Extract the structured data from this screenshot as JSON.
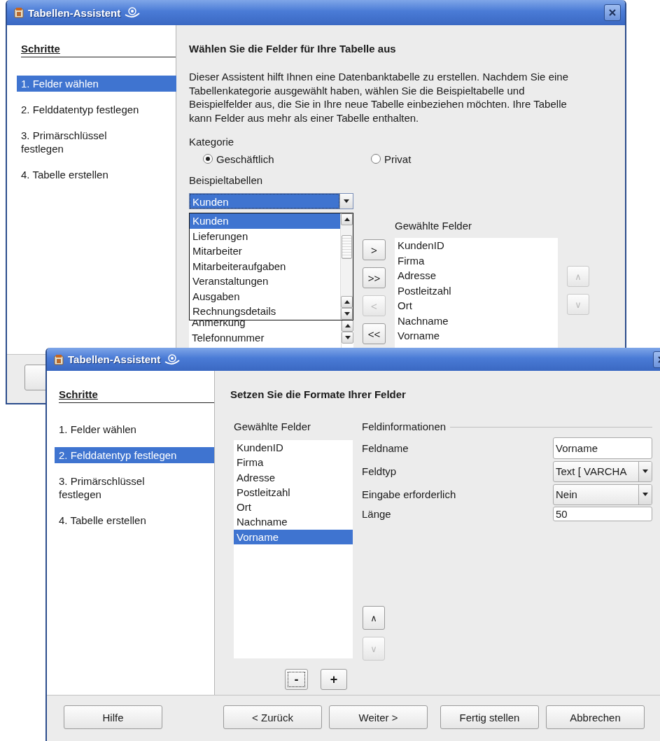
{
  "back_window": {
    "title": "Tabellen-Assistent",
    "steps_heading": "Schritte",
    "steps": [
      {
        "label": "1. Felder wählen",
        "selected": true
      },
      {
        "label": "2. Felddatentyp festlegen",
        "selected": false
      },
      {
        "label": "3. Primärschlüssel festlegen",
        "selected": false
      },
      {
        "label": "4. Tabelle erstellen",
        "selected": false
      }
    ],
    "heading": "Wählen Sie die Felder für Ihre Tabelle aus",
    "description": "Dieser Assistent hilft Ihnen eine Datenbanktabelle zu erstellen. Nachdem Sie eine Tabellenkategorie ausgewählt haben, wählen Sie die Beispieltabelle und Beispielfelder aus, die Sie in Ihre neue Tabelle einbeziehen möchten. Ihre Tabelle kann Felder aus mehr als einer Tabelle enthalten.",
    "category": {
      "label": "Kategorie",
      "options": [
        {
          "label": "Geschäftlich",
          "selected": true
        },
        {
          "label": "Privat",
          "selected": false
        }
      ]
    },
    "sample_tables": {
      "label": "Beispieltabellen",
      "value": "Kunden",
      "dropdown": [
        {
          "label": "Kunden",
          "selected": true
        },
        {
          "label": "Lieferungen",
          "selected": false
        },
        {
          "label": "Mitarbeiter",
          "selected": false
        },
        {
          "label": "Mitarbeiteraufgaben",
          "selected": false
        },
        {
          "label": "Veranstaltungen",
          "selected": false
        },
        {
          "label": "Ausgaben",
          "selected": false
        },
        {
          "label": "Rechnungsdetails",
          "selected": false
        }
      ]
    },
    "available_fields": [
      "Anmerkung",
      "Telefonnummer"
    ],
    "move_buttons": [
      {
        "label": ">",
        "disabled": false
      },
      {
        "label": ">>",
        "disabled": false
      },
      {
        "label": "<",
        "disabled": true
      },
      {
        "label": "<<",
        "disabled": false
      }
    ],
    "selected_fields": {
      "label": "Gewählte Felder",
      "items": [
        "KundenID",
        "Firma",
        "Adresse",
        "Postleitzahl",
        "Ort",
        "Nachname",
        "Vorname"
      ]
    },
    "order_buttons": [
      {
        "label": "∧",
        "disabled": true
      },
      {
        "label": "∨",
        "disabled": true
      }
    ]
  },
  "front_window": {
    "title": "Tabellen-Assistent",
    "steps_heading": "Schritte",
    "steps": [
      {
        "label": "1. Felder wählen",
        "selected": false
      },
      {
        "label": "2. Felddatentyp festlegen",
        "selected": true
      },
      {
        "label": "3. Primärschlüssel festlegen",
        "selected": false
      },
      {
        "label": "4. Tabelle erstellen",
        "selected": false
      }
    ],
    "heading": "Setzen Sie die Formate Ihrer Felder",
    "selected_fields": {
      "label": "Gewählte Felder",
      "items": [
        {
          "label": "KundenID",
          "selected": false
        },
        {
          "label": "Firma",
          "selected": false
        },
        {
          "label": "Adresse",
          "selected": false
        },
        {
          "label": "Postleitzahl",
          "selected": false
        },
        {
          "label": "Ort",
          "selected": false
        },
        {
          "label": "Nachname",
          "selected": false
        },
        {
          "label": "Vorname",
          "selected": true
        }
      ]
    },
    "field_info": {
      "heading": "Feldinformationen",
      "rows": [
        {
          "kind": "input",
          "label": "Feldname",
          "value": "Vorname"
        },
        {
          "kind": "select",
          "label": "Feldtyp",
          "value": "Text [ VARCHA"
        },
        {
          "kind": "select",
          "label": "Eingabe erforderlich",
          "value": "Nein"
        },
        {
          "kind": "input",
          "label": "Länge",
          "value": "50"
        }
      ]
    },
    "order_buttons": [
      {
        "label": "∧",
        "disabled": false
      },
      {
        "label": "∨",
        "disabled": true
      }
    ],
    "edit_buttons": [
      {
        "label": "-",
        "focused": true
      },
      {
        "label": "+",
        "focused": false
      }
    ],
    "footer_buttons": [
      "Hilfe",
      "< Zurück",
      "Weiter >",
      "Fertig stellen",
      "Abbrechen"
    ]
  }
}
